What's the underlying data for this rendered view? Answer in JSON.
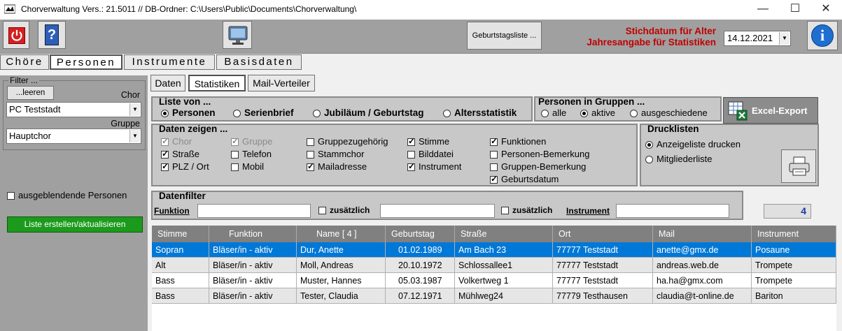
{
  "window": {
    "title": "Chorverwaltung Vers.: 21.5011 // DB-Ordner: C:\\Users\\Public\\Documents\\Chorverwaltung\\",
    "minimize": "—",
    "maximize": "☐",
    "close": "✕"
  },
  "toolbar": {
    "birthday_list_label": "Geburtstagsliste ...",
    "stichdatum_line1": "Stichdatum für Alter",
    "stichdatum_line2": "Jahresangabe für Statistiken",
    "date_value": "14.12.2021",
    "info_label": "i"
  },
  "main_tabs": [
    "Chöre",
    "Personen",
    "Instrumente",
    "Basisdaten"
  ],
  "filter": {
    "legend": "Filter ...",
    "clear_label": "...leeren",
    "chor_label": "Chor",
    "chor_value": "PC Teststadt",
    "gruppe_label": "Gruppe",
    "gruppe_value": "Hauptchor",
    "hidden_persons_label": "ausgeblendende Personen",
    "create_list_label": "Liste erstellen/aktualisieren"
  },
  "sub_tabs": [
    "Daten",
    "Statistiken",
    "Mail-Verteiler"
  ],
  "liste_von": {
    "title": "Liste von ...",
    "options": [
      "Personen",
      "Serienbrief",
      "Jubiläum / Geburtstag",
      "Altersstatistik"
    ],
    "selected": "Personen"
  },
  "personen_in_gruppen": {
    "title": "Personen in Gruppen ...",
    "options": [
      "alle",
      "aktive",
      "ausgeschiedene"
    ],
    "selected": "aktive"
  },
  "excel_export_label": "Excel-Export",
  "daten_zeigen": {
    "title": "Daten zeigen ...",
    "items": [
      {
        "label": "Chor",
        "checked": true,
        "disabled": true
      },
      {
        "label": "Straße",
        "checked": true,
        "disabled": false
      },
      {
        "label": "PLZ / Ort",
        "checked": true,
        "disabled": false
      },
      {
        "label": "Gruppe",
        "checked": true,
        "disabled": true
      },
      {
        "label": "Telefon",
        "checked": false,
        "disabled": false
      },
      {
        "label": "Mobil",
        "checked": false,
        "disabled": false
      },
      {
        "label": "Gruppezugehörig",
        "checked": false,
        "disabled": false
      },
      {
        "label": "Stammchor",
        "checked": false,
        "disabled": false
      },
      {
        "label": "Mailadresse",
        "checked": true,
        "disabled": false
      },
      {
        "label": "Stimme",
        "checked": true,
        "disabled": false
      },
      {
        "label": "Bilddatei",
        "checked": false,
        "disabled": false
      },
      {
        "label": "Instrument",
        "checked": true,
        "disabled": false
      },
      {
        "label": "Funktionen",
        "checked": true,
        "disabled": false
      },
      {
        "label": "Personen-Bemerkung",
        "checked": false,
        "disabled": false
      },
      {
        "label": "Gruppen-Bemerkung",
        "checked": false,
        "disabled": false
      },
      {
        "label": "Geburtsdatum",
        "checked": true,
        "disabled": false
      }
    ]
  },
  "drucklisten": {
    "title": "Drucklisten",
    "options": [
      "Anzeigeliste drucken",
      "Mitgliederliste"
    ],
    "selected": "Anzeigeliste drucken"
  },
  "datenfilter": {
    "title": "Datenfilter",
    "funktion_label": "Funktion",
    "zusaetzlich1_label": "zusätzlich",
    "zusaetzlich2_label": "zusätzlich",
    "instrument_label": "Instrument",
    "count": "4"
  },
  "table": {
    "columns": [
      "Stimme",
      "Funktion",
      "Name  [ 4 ]",
      "Geburtstag",
      "Straße",
      "Ort",
      "Mail",
      "Instrument"
    ],
    "rows": [
      [
        "Sopran",
        "Bläser/in - aktiv",
        "Dur, Anette",
        "01.02.1989",
        "Am Bach 23",
        "77777 Teststadt",
        "anette@gmx.de",
        "Posaune"
      ],
      [
        "Alt",
        "Bläser/in - aktiv",
        "Moll, Andreas",
        "20.10.1972",
        "Schlossallee1",
        "77777 Teststadt",
        "andreas.web.de",
        "Trompete"
      ],
      [
        "Bass",
        "Bläser/in - aktiv",
        "Muster, Hannes",
        "05.03.1987",
        "Volkertweg 1",
        "77777 Teststadt",
        "ha.ha@gmx.com",
        "Trompete"
      ],
      [
        "Bass",
        "Bläser/in - aktiv",
        "Tester, Claudia",
        "07.12.1971",
        "Mühlweg24",
        "77779 Testhausen",
        "claudia@t-online.de",
        "Bariton"
      ]
    ]
  },
  "colors": {
    "accent_red": "#c00000",
    "selection_blue": "#0078d7",
    "button_green": "#1c9a1c",
    "panel_gray": "#a0a0a0"
  }
}
